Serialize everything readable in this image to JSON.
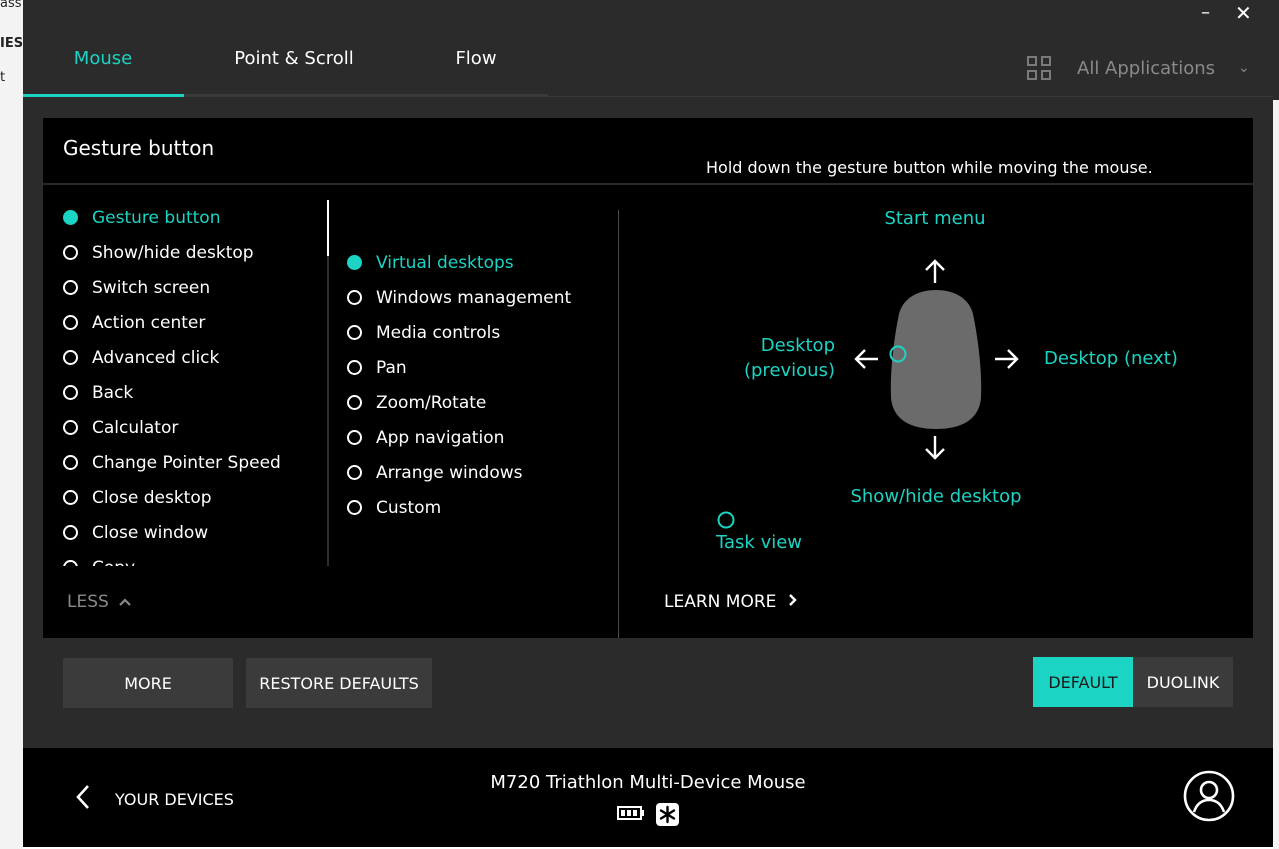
{
  "tabs": [
    {
      "label": "Mouse",
      "active": true
    },
    {
      "label": "Point & Scroll",
      "active": false
    },
    {
      "label": "Flow",
      "active": false
    }
  ],
  "window": {
    "minimize": "–",
    "close": "✕"
  },
  "app_filter": {
    "label": "All Applications",
    "icon": "grid-icon"
  },
  "panel": {
    "title": "Gesture button",
    "hint": "Hold down the gesture button while moving the mouse."
  },
  "actions_list": [
    {
      "label": "Gesture button",
      "selected": true
    },
    {
      "label": "Show/hide desktop",
      "selected": false
    },
    {
      "label": "Switch screen",
      "selected": false
    },
    {
      "label": "Action center",
      "selected": false
    },
    {
      "label": "Advanced click",
      "selected": false
    },
    {
      "label": "Back",
      "selected": false
    },
    {
      "label": "Calculator",
      "selected": false
    },
    {
      "label": "Change Pointer Speed",
      "selected": false
    },
    {
      "label": "Close desktop",
      "selected": false
    },
    {
      "label": "Close window",
      "selected": false
    },
    {
      "label": "Copy",
      "selected": false
    }
  ],
  "presets_list": [
    {
      "label": "Virtual desktops",
      "selected": true
    },
    {
      "label": "Windows management",
      "selected": false
    },
    {
      "label": "Media controls",
      "selected": false
    },
    {
      "label": "Pan",
      "selected": false
    },
    {
      "label": "Zoom/Rotate",
      "selected": false
    },
    {
      "label": "App navigation",
      "selected": false
    },
    {
      "label": "Arrange windows",
      "selected": false
    },
    {
      "label": "Custom",
      "selected": false
    }
  ],
  "less_label": "LESS",
  "learn_more_label": "LEARN MORE",
  "gesture_map": {
    "up": "Start menu",
    "left_line1": "Desktop",
    "left_line2": "(previous)",
    "right": "Desktop (next)",
    "down": "Show/hide desktop",
    "click": "Task view"
  },
  "buttons": {
    "more": "MORE",
    "restore": "RESTORE DEFAULTS",
    "default": "DEFAULT",
    "duolink": "DUOLINK"
  },
  "footer": {
    "your_devices": "YOUR DEVICES",
    "device_name": "M720 Triathlon Multi-Device Mouse"
  },
  "background_window": {
    "fragments": [
      "ass",
      "IES",
      "t"
    ]
  },
  "colors": {
    "accent": "#1cd4c4",
    "background": "#2b2b2b",
    "panel": "#000000",
    "button": "#3b3b3b",
    "mouse_shape": "#6b6b6b"
  }
}
